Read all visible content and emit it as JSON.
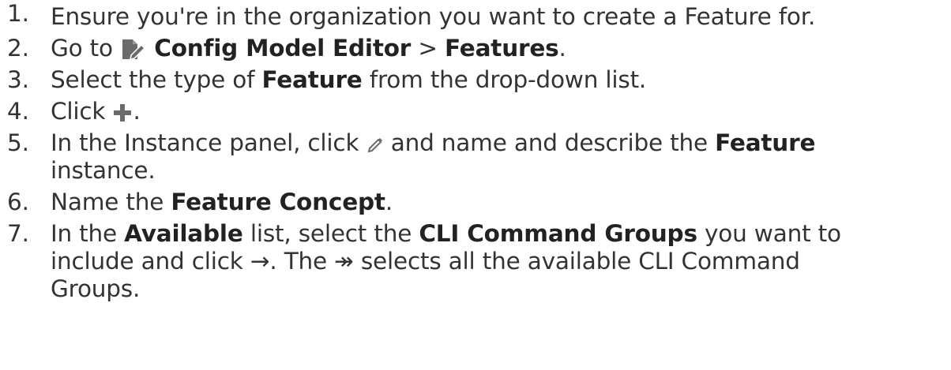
{
  "steps": [
    {
      "num": "1.",
      "text": "Ensure you're in the organization you want to create a Feature for."
    },
    {
      "num": "2.",
      "pre": "Go to ",
      "icon": "config-model-editor-icon",
      "bold1": "Config Model Editor",
      "mid": " > ",
      "bold2": "Features",
      "post": "."
    },
    {
      "num": "3.",
      "pre": "Select the type of ",
      "bold1": "Feature",
      "post": " from the drop-down list."
    },
    {
      "num": "4.",
      "pre": "Click ",
      "icon": "plus-icon",
      "post": "."
    },
    {
      "num": "5.",
      "pre": "In the Instance panel, click ",
      "icon": "pencil-icon",
      "mid": " and name and describe the ",
      "bold1": "Feature",
      "line2": "instance."
    },
    {
      "num": "6.",
      "pre": "Name the ",
      "bold1": "Feature Concept",
      "post": "."
    },
    {
      "num": "7.",
      "pre": "In the ",
      "bold1": "Available",
      "mid": " list, select the ",
      "bold2": "CLI Command Groups",
      "post": " you want to",
      "line2_pre": "include and click ",
      "arrow1": "→",
      "line2_mid": ". The ",
      "arrow2": "↠",
      "line2_post": " selects all the available CLI Command",
      "line3": "Groups."
    }
  ],
  "colors": {
    "text": "#333333",
    "icon_gray": "#6b6b6b"
  }
}
